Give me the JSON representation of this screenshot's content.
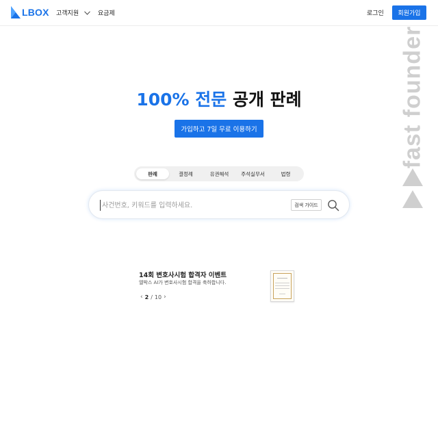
{
  "header": {
    "logo_text": "LBOX",
    "nav": {
      "support_label": "고객지원",
      "pricing_label": "요금제"
    },
    "login_label": "로그인",
    "signup_label": "회원가입"
  },
  "watermark": {
    "text": "fast founder"
  },
  "hero": {
    "title_accent": "100% 전문",
    "title_rest": " 공개 판례",
    "cta_label": "가입하고 7일 무료 이용하기"
  },
  "tabs": [
    {
      "label": "판례",
      "active": true
    },
    {
      "label": "결정례",
      "active": false
    },
    {
      "label": "유권해석",
      "active": false
    },
    {
      "label": "주석실무서",
      "active": false
    },
    {
      "label": "법령",
      "active": false
    }
  ],
  "search": {
    "placeholder": "사건번호, 키워드를 입력하세요.",
    "value": "",
    "guide_label": "검색 가이드"
  },
  "banner": {
    "title": "14회 변호사시험 합격자 이벤트",
    "subtitle": "엘박스 AI가 변호사시험 합격을 축하합니다.",
    "page_current": "2",
    "page_separator": "/",
    "page_total": "10"
  },
  "colors": {
    "brand": "#1a73e8",
    "watermark": "#cfcfcf"
  },
  "icons": {
    "chevron": "chevron-down-icon",
    "search": "search-icon",
    "prev": "chevron-left-icon",
    "next": "chevron-right-icon"
  }
}
